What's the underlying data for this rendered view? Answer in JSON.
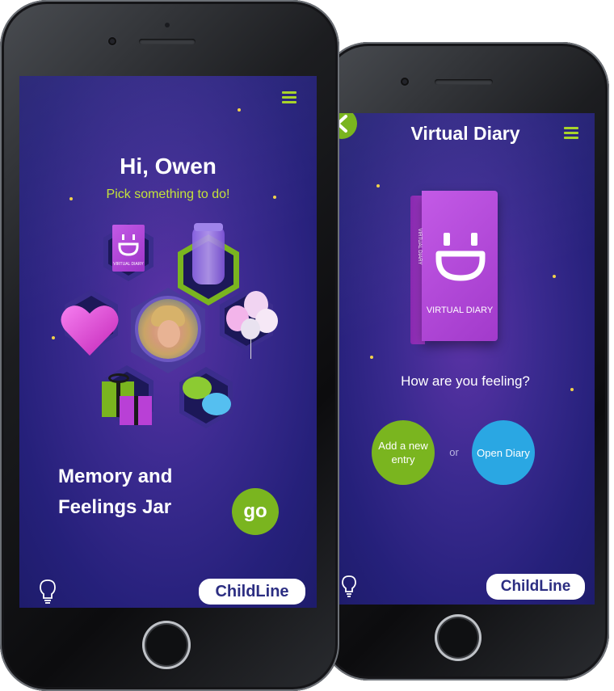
{
  "home_screen": {
    "greeting": "Hi, Owen",
    "prompt": "Pick something to do!",
    "tiles": [
      {
        "name": "virtual-diary",
        "label": "VIRTUAL DIARY",
        "icon": "diary-icon"
      },
      {
        "name": "jar",
        "icon": "jar-icon"
      },
      {
        "name": "heart",
        "icon": "heart-icon"
      },
      {
        "name": "profile-photo",
        "icon": "avatar"
      },
      {
        "name": "balloons",
        "icon": "balloons-icon"
      },
      {
        "name": "gifts",
        "icon": "gift-icon"
      },
      {
        "name": "chat",
        "icon": "chat-bubbles-icon"
      }
    ],
    "feature_title_line1": "Memory and",
    "feature_title_line2": "Feelings Jar",
    "go_label": "go",
    "brand": "ChildLine"
  },
  "diary_screen": {
    "title": "Virtual Diary",
    "book_label": "VIRTUAL DIARY",
    "book_spine_label": "VIRTUAL DIARY",
    "question": "How are you feeling?",
    "add_entry_label": "Add a new entry",
    "or_label": "or",
    "open_diary_label": "Open Diary",
    "brand": "ChildLine"
  },
  "colors": {
    "accent_green": "#7ab51f",
    "accent_blue": "#2aa7e3",
    "diary_purple": "#b43fd6",
    "text_lime": "#c4e23a",
    "screen_bg": "#2b2380"
  }
}
